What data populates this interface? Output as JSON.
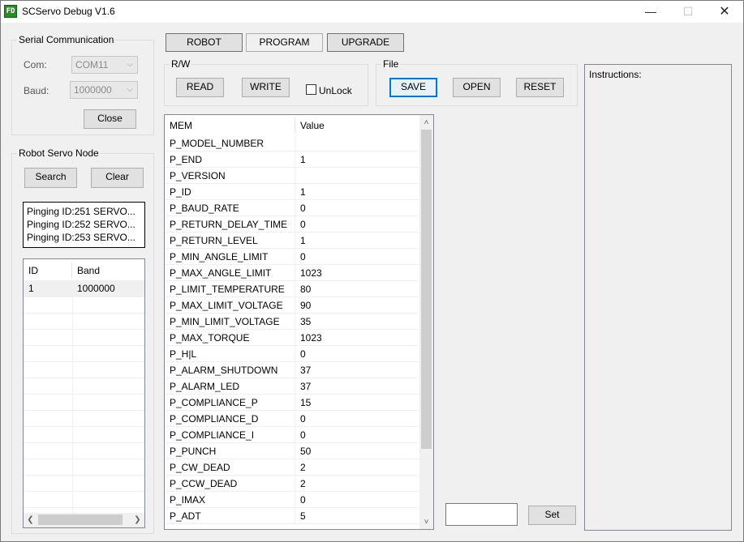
{
  "window": {
    "title": "SCServo Debug V1.6",
    "icon_text": "FD"
  },
  "serial": {
    "title": "Serial Communication",
    "com_label": "Com:",
    "com_value": "COM11",
    "baud_label": "Baud:",
    "baud_value": "1000000",
    "close_label": "Close"
  },
  "node": {
    "title": "Robot Servo Node",
    "search_label": "Search",
    "clear_label": "Clear",
    "log": [
      "Pinging ID:251 SERVO...",
      "Pinging ID:252 SERVO...",
      "Pinging ID:253 SERVO..."
    ],
    "columns": [
      "ID",
      "Band"
    ],
    "rows": [
      [
        "1",
        "1000000"
      ]
    ]
  },
  "tabs": [
    "ROBOT",
    "PROGRAM",
    "UPGRADE"
  ],
  "rw": {
    "title": "R/W",
    "read_label": "READ",
    "write_label": "WRITE",
    "unlock_label": "UnLock"
  },
  "file": {
    "title": "File",
    "save_label": "SAVE",
    "open_label": "OPEN",
    "reset_label": "RESET"
  },
  "mem_table": {
    "columns": [
      "MEM",
      "Value"
    ],
    "rows": [
      [
        "P_MODEL_NUMBER",
        ""
      ],
      [
        "P_END",
        "1"
      ],
      [
        "P_VERSION",
        ""
      ],
      [
        "P_ID",
        "1"
      ],
      [
        "P_BAUD_RATE",
        "0"
      ],
      [
        "P_RETURN_DELAY_TIME",
        "0"
      ],
      [
        "P_RETURN_LEVEL",
        "1"
      ],
      [
        "P_MIN_ANGLE_LIMIT",
        "0"
      ],
      [
        "P_MAX_ANGLE_LIMIT",
        "1023"
      ],
      [
        "P_LIMIT_TEMPERATURE",
        "80"
      ],
      [
        "P_MAX_LIMIT_VOLTAGE",
        "90"
      ],
      [
        "P_MIN_LIMIT_VOLTAGE",
        "35"
      ],
      [
        "P_MAX_TORQUE",
        "1023"
      ],
      [
        "P_H|L",
        "0"
      ],
      [
        "P_ALARM_SHUTDOWN",
        "37"
      ],
      [
        "P_ALARM_LED",
        "37"
      ],
      [
        "P_COMPLIANCE_P",
        "15"
      ],
      [
        "P_COMPLIANCE_D",
        "0"
      ],
      [
        "P_COMPLIANCE_I",
        "0"
      ],
      [
        "P_PUNCH",
        "50"
      ],
      [
        "P_CW_DEAD",
        "2"
      ],
      [
        "P_CCW_DEAD",
        "2"
      ],
      [
        "P_IMAX",
        "0"
      ],
      [
        "P_ADT",
        "5"
      ]
    ]
  },
  "set": {
    "value": "",
    "button_label": "Set"
  },
  "instructions": {
    "title": "Instructions:"
  }
}
